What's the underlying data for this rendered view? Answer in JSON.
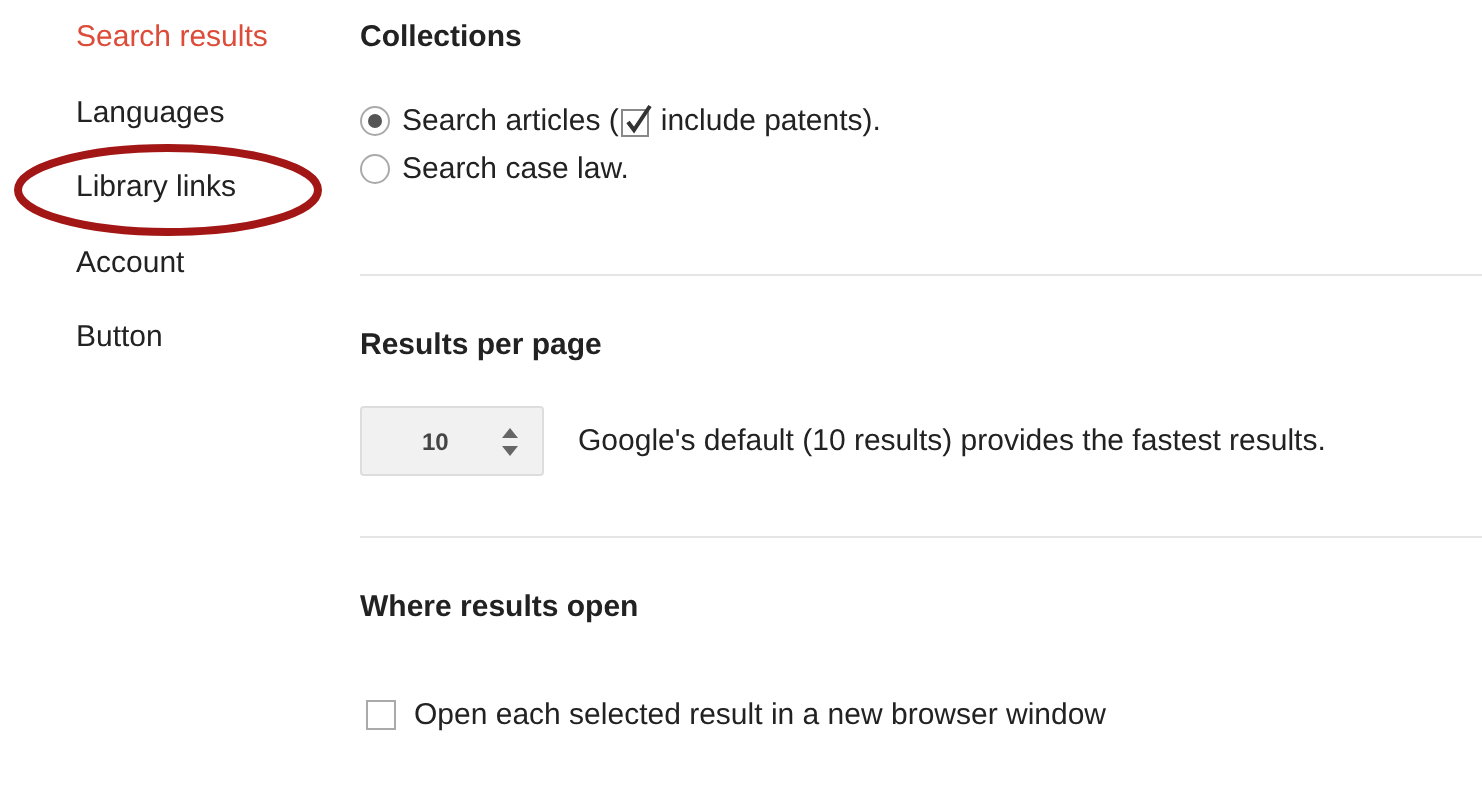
{
  "sidebar": {
    "items": [
      {
        "label": "Search results",
        "selected": true,
        "circled": false
      },
      {
        "label": "Languages",
        "selected": false,
        "circled": false
      },
      {
        "label": "Library links",
        "selected": false,
        "circled": true
      },
      {
        "label": "Account",
        "selected": false,
        "circled": false
      },
      {
        "label": "Button",
        "selected": false,
        "circled": false
      }
    ]
  },
  "sections": [
    {
      "kind": "collections",
      "title": "Collections",
      "options": [
        {
          "selected": true,
          "before": "Search articles (",
          "checkbox_checked": true,
          "label": "include patents)."
        },
        {
          "selected": false,
          "label": "Search case law."
        }
      ]
    },
    {
      "kind": "per_page",
      "title": "Results per page",
      "value": "10",
      "note": "Google's default (10 results) provides the fastest results."
    },
    {
      "kind": "open",
      "title": "Where results open",
      "checkbox": {
        "label": "Open each selected result in a new browser window",
        "checked": false
      }
    }
  ]
}
